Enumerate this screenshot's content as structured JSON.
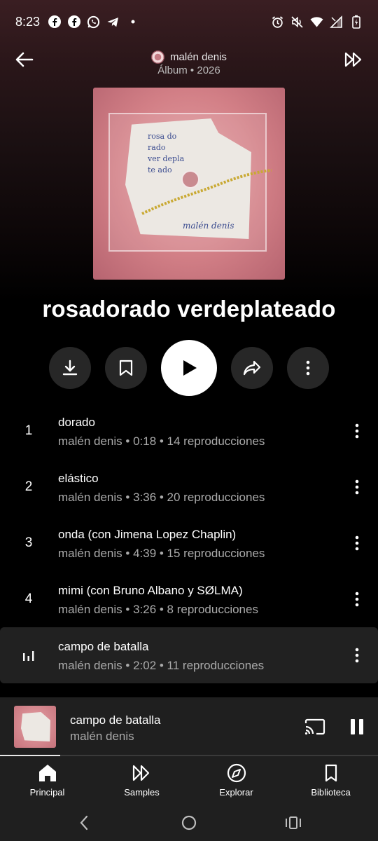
{
  "status_bar": {
    "time": "8:23",
    "left_icons": [
      "facebook-icon",
      "facebook-icon",
      "whatsapp-icon",
      "telegram-icon",
      "dot-icon"
    ],
    "right_icons": [
      "alarm-icon",
      "mute-icon",
      "wifi-icon",
      "signal-icon",
      "battery-icon"
    ]
  },
  "header": {
    "artist": "malén denis",
    "meta": "Álbum • 2026"
  },
  "cover": {
    "text": "rosa do\nrado\nver depla\nte ado",
    "signature": "malén denis"
  },
  "album": {
    "title": "rosadorado verdeplateado"
  },
  "tracks": [
    {
      "num": "1",
      "title": "dorado",
      "subtitle": "malén denis • 0:18 • 14 reproducciones"
    },
    {
      "num": "2",
      "title": "elástico",
      "subtitle": "malén denis • 3:36 • 20 reproducciones"
    },
    {
      "num": "3",
      "title": "onda (con Jimena Lopez Chaplin)",
      "subtitle": "malén denis • 4:39 • 15 reproducciones"
    },
    {
      "num": "4",
      "title": "mimi (con Bruno Albano y SØLMA)",
      "subtitle": "malén denis • 3:26 • 8 reproducciones"
    },
    {
      "num": "",
      "title": "campo de batalla",
      "subtitle": "malén denis • 2:02 • 11 reproducciones",
      "playing": true
    }
  ],
  "mini_player": {
    "title": "campo de batalla",
    "artist": "malén denis",
    "progress": 0.16
  },
  "nav": {
    "items": [
      {
        "label": "Principal",
        "icon": "home-icon"
      },
      {
        "label": "Samples",
        "icon": "samples-icon"
      },
      {
        "label": "Explorar",
        "icon": "compass-icon"
      },
      {
        "label": "Biblioteca",
        "icon": "bookmark-icon"
      }
    ]
  },
  "colors": {
    "background": "#000000",
    "surface": "#1f1f1f",
    "active_row": "#212121",
    "secondary_text": "#aaaaaa"
  }
}
